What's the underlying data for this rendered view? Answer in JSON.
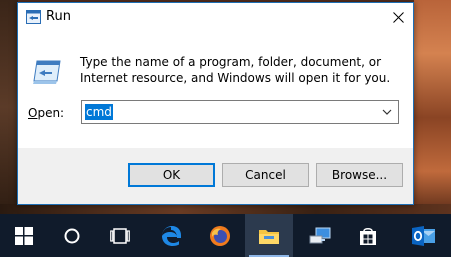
{
  "dialog": {
    "title": "Run",
    "description": "Type the name of a program, folder, document, or Internet resource, and Windows will open it for you.",
    "open_label_prefix": "O",
    "open_label_rest": "pen:",
    "input_value": "cmd",
    "buttons": {
      "ok": "OK",
      "cancel": "Cancel",
      "browse": "Browse..."
    },
    "accent_color": "#0078d7"
  },
  "taskbar": {
    "items": [
      {
        "name": "windows-start",
        "icon": "windows-logo-icon"
      },
      {
        "name": "cortana-search",
        "icon": "circle-search-icon"
      },
      {
        "name": "task-view",
        "icon": "task-view-icon"
      },
      {
        "name": "edge",
        "icon": "edge-icon"
      },
      {
        "name": "firefox",
        "icon": "firefox-icon"
      },
      {
        "name": "file-explorer",
        "icon": "folder-icon"
      },
      {
        "name": "network",
        "icon": "computer-icon"
      },
      {
        "name": "store",
        "icon": "store-bag-icon"
      },
      {
        "name": "outlook",
        "icon": "outlook-icon"
      }
    ]
  }
}
